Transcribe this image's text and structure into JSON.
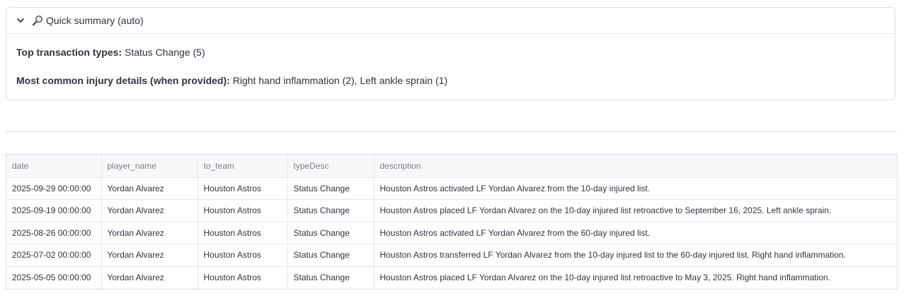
{
  "summary": {
    "header_label": "Quick summary (auto)",
    "top_types_label": "Top transaction types:",
    "top_types_value": "Status Change (5)",
    "injury_label": "Most common injury details (when provided):",
    "injury_value": "Right hand inflammation (2), Left ankle sprain (1)"
  },
  "table": {
    "columns": [
      "date",
      "player_name",
      "to_team",
      "typeDesc",
      "description"
    ],
    "rows": [
      [
        "2025-09-29 00:00:00",
        "Yordan Alvarez",
        "Houston Astros",
        "Status Change",
        "Houston Astros activated LF Yordan Alvarez from the 10-day injured list."
      ],
      [
        "2025-09-19 00:00:00",
        "Yordan Alvarez",
        "Houston Astros",
        "Status Change",
        "Houston Astros placed LF Yordan Alvarez on the 10-day injured list retroactive to September 16, 2025. Left ankle sprain."
      ],
      [
        "2025-08-26 00:00:00",
        "Yordan Alvarez",
        "Houston Astros",
        "Status Change",
        "Houston Astros activated LF Yordan Alvarez from the 60-day injured list."
      ],
      [
        "2025-07-02 00:00:00",
        "Yordan Alvarez",
        "Houston Astros",
        "Status Change",
        "Houston Astros transferred LF Yordan Alvarez from the 10-day injured list to the 60-day injured list. Right hand inflammation."
      ],
      [
        "2025-05-05 00:00:00",
        "Yordan Alvarez",
        "Houston Astros",
        "Status Change",
        "Houston Astros placed LF Yordan Alvarez on the 10-day injured list retroactive to May 3, 2025. Right hand inflammation."
      ]
    ]
  }
}
